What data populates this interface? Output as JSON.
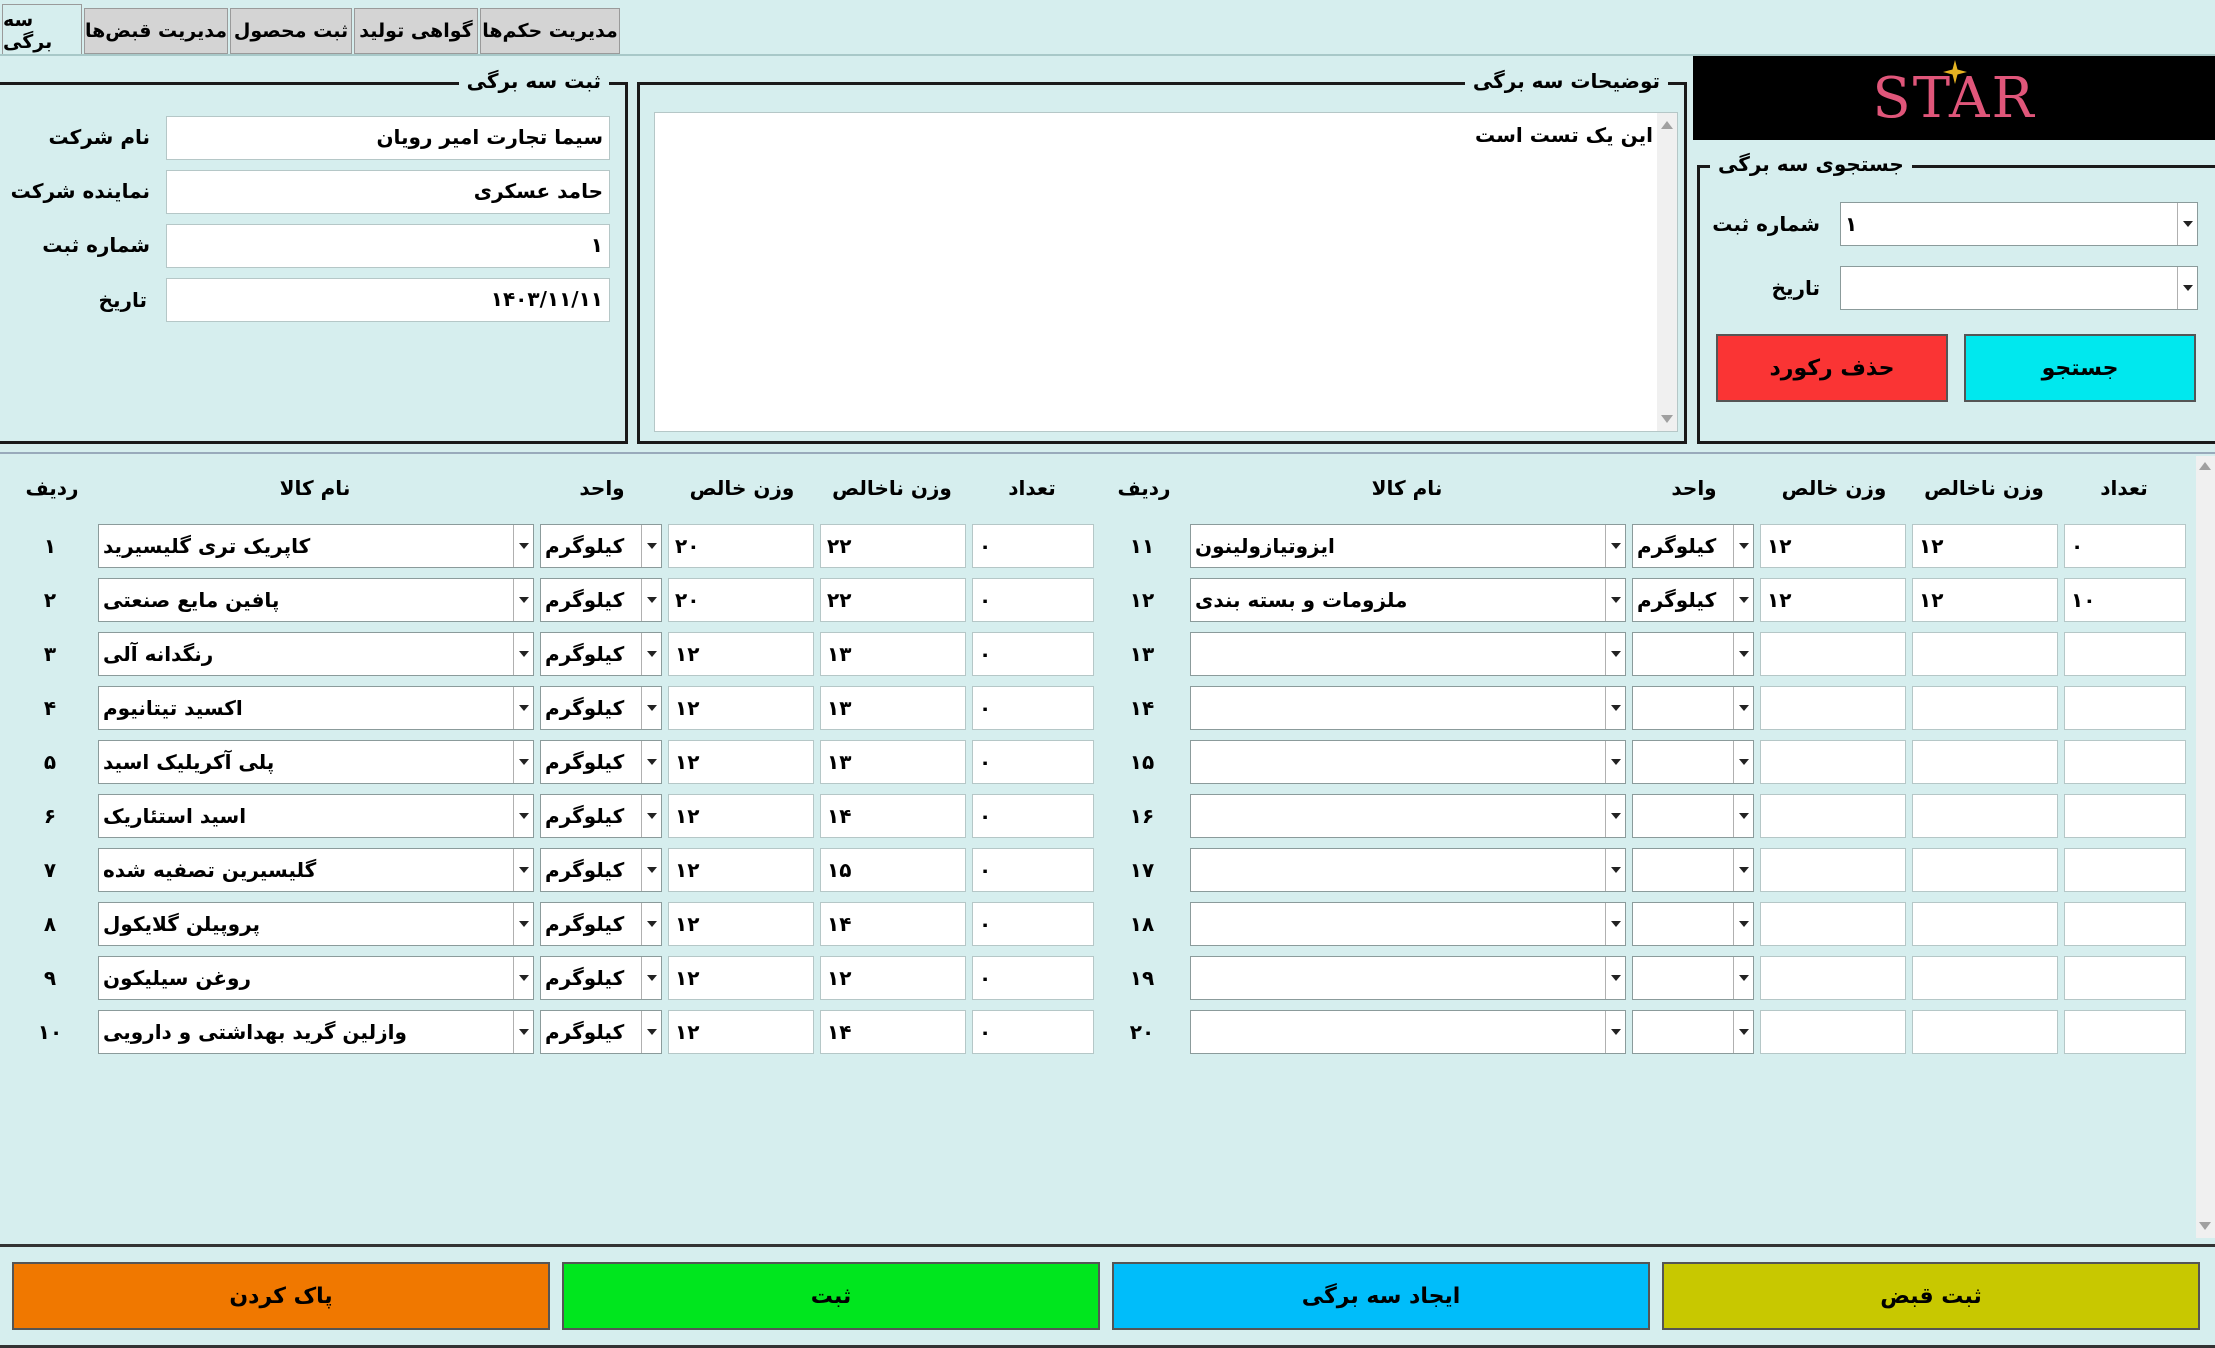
{
  "tabs": [
    {
      "label": "سه برگی",
      "active": true
    },
    {
      "label": "مدیریت قبض‌ها",
      "active": false
    },
    {
      "label": "ثبت محصول",
      "active": false
    },
    {
      "label": "گواهی تولید",
      "active": false
    },
    {
      "label": "مدیریت حکم‌ها",
      "active": false
    }
  ],
  "register": {
    "title": "ثبت سه برگی",
    "company_label": "نام شرکت",
    "company_value": "سیما تجارت امیر رویان",
    "rep_label": "نماینده شرکت",
    "rep_value": "حامد عسکری",
    "regno_label": "شماره ثبت",
    "regno_value": "۱",
    "date_label": "تاریخ",
    "date_value": "۱۴۰۳/۱۱/۱۱"
  },
  "description": {
    "title": "توضیحات سه برگی",
    "text": "این یک تست است"
  },
  "logo": {
    "text": "STAR",
    "color": "#e0567a"
  },
  "search": {
    "title": "جستجوی سه برگی",
    "regno_label": "شماره ثبت",
    "regno_value": "۱",
    "date_label": "تاریخ",
    "date_value": "",
    "search_button": "جستجو",
    "delete_button": "حذف رکورد"
  },
  "table_headers": {
    "row": "ردیف",
    "name": "نام کالا",
    "unit": "واحد",
    "net": "وزن خالص",
    "gross": "وزن ناخالص",
    "count": "تعداد"
  },
  "rows_left": [
    {
      "no": "۱",
      "name": "کاپریک تری گلیسیرید",
      "unit": "کیلوگرم",
      "net": "۲۰",
      "gross": "۲۲",
      "count": "۰"
    },
    {
      "no": "۲",
      "name": "پافین مایع صنعتی",
      "unit": "کیلوگرم",
      "net": "۲۰",
      "gross": "۲۲",
      "count": "۰"
    },
    {
      "no": "۳",
      "name": "رنگدانه آلی",
      "unit": "کیلوگرم",
      "net": "۱۲",
      "gross": "۱۳",
      "count": "۰"
    },
    {
      "no": "۴",
      "name": "اکسید تیتانیوم",
      "unit": "کیلوگرم",
      "net": "۱۲",
      "gross": "۱۳",
      "count": "۰"
    },
    {
      "no": "۵",
      "name": "پلی آکریلیک اسید",
      "unit": "کیلوگرم",
      "net": "۱۲",
      "gross": "۱۳",
      "count": "۰"
    },
    {
      "no": "۶",
      "name": "اسید استئاریک",
      "unit": "کیلوگرم",
      "net": "۱۲",
      "gross": "۱۴",
      "count": "۰"
    },
    {
      "no": "۷",
      "name": "گلیسیرین تصفیه شده",
      "unit": "کیلوگرم",
      "net": "۱۲",
      "gross": "۱۵",
      "count": "۰"
    },
    {
      "no": "۸",
      "name": "پروپیلن گلایکول",
      "unit": "کیلوگرم",
      "net": "۱۲",
      "gross": "۱۴",
      "count": "۰"
    },
    {
      "no": "۹",
      "name": "روغن سیلیکون",
      "unit": "کیلوگرم",
      "net": "۱۲",
      "gross": "۱۲",
      "count": "۰"
    },
    {
      "no": "۱۰",
      "name": "وازلین گرید بهداشتی و دارویی",
      "unit": "کیلوگرم",
      "net": "۱۲",
      "gross": "۱۴",
      "count": "۰"
    }
  ],
  "rows_right": [
    {
      "no": "۱۱",
      "name": "ایزوتیازولینون",
      "unit": "کیلوگرم",
      "net": "۱۲",
      "gross": "۱۲",
      "count": "۰"
    },
    {
      "no": "۱۲",
      "name": "ملزومات و بسته بندی",
      "unit": "کیلوگرم",
      "net": "۱۲",
      "gross": "۱۲",
      "count": "۱۰"
    },
    {
      "no": "۱۳",
      "name": "",
      "unit": "",
      "net": "",
      "gross": "",
      "count": ""
    },
    {
      "no": "۱۴",
      "name": "",
      "unit": "",
      "net": "",
      "gross": "",
      "count": ""
    },
    {
      "no": "۱۵",
      "name": "",
      "unit": "",
      "net": "",
      "gross": "",
      "count": ""
    },
    {
      "no": "۱۶",
      "name": "",
      "unit": "",
      "net": "",
      "gross": "",
      "count": ""
    },
    {
      "no": "۱۷",
      "name": "",
      "unit": "",
      "net": "",
      "gross": "",
      "count": ""
    },
    {
      "no": "۱۸",
      "name": "",
      "unit": "",
      "net": "",
      "gross": "",
      "count": ""
    },
    {
      "no": "۱۹",
      "name": "",
      "unit": "",
      "net": "",
      "gross": "",
      "count": ""
    },
    {
      "no": "۲۰",
      "name": "",
      "unit": "",
      "net": "",
      "gross": "",
      "count": ""
    }
  ],
  "bottom_buttons": [
    {
      "label": "پاک کردن",
      "color": "#f07800"
    },
    {
      "label": "ثبت",
      "color": "#00e61e"
    },
    {
      "label": "ایجاد سه برگی",
      "color": "#00bdfa"
    },
    {
      "label": "ثبت قبض",
      "color": "#c8c800"
    }
  ],
  "colors": {
    "background": "#d6eeee",
    "search_button": "#00e8ee",
    "delete_button": "#fa3434"
  }
}
